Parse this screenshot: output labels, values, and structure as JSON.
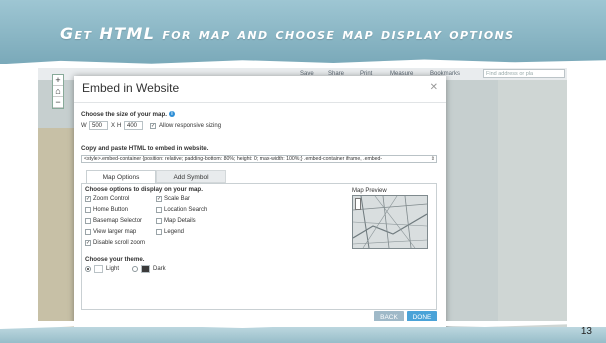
{
  "slide": {
    "title": "Get HTML for map and choose map display options",
    "page_number": "13"
  },
  "map_app": {
    "toolbar": {
      "save": "Save",
      "share": "Share",
      "print": "Print",
      "measure": "Measure",
      "bookmarks": "Bookmarks",
      "find_placeholder": "Find address or pla"
    }
  },
  "dialog": {
    "title": "Embed in Website",
    "size_label": "Choose the size of your map.",
    "width_prefix": "W",
    "width": "500",
    "x_sep": "X",
    "height_prefix": "H",
    "height": "400",
    "responsive_label": "Allow responsive sizing",
    "copy_label": "Copy and paste HTML to embed in website.",
    "html_code": "<style>.embed-container {position: relative; padding-bottom: 80%; height: 0; max-width: 100%;} .embed-container iframe, .embed-",
    "tabs": [
      "Map Options",
      "Add Symbol"
    ],
    "options_label": "Choose options to display on your map.",
    "options_left": [
      {
        "label": "Zoom Control",
        "checked": "yes"
      },
      {
        "label": "Home Button",
        "checked": "no"
      },
      {
        "label": "Basemap Selector",
        "checked": "no"
      },
      {
        "label": "View larger map",
        "checked": "no"
      },
      {
        "label": "Disable scroll zoom",
        "checked": "yes"
      }
    ],
    "options_right": [
      {
        "label": "Scale Bar",
        "checked": "yes"
      },
      {
        "label": "Location Search",
        "checked": "no"
      },
      {
        "label": "Map Details",
        "checked": "no"
      },
      {
        "label": "Legend",
        "checked": "no"
      }
    ],
    "preview_label": "Map Preview",
    "theme_label": "Choose your theme.",
    "theme_light": "Light",
    "theme_dark": "Dark",
    "selected_theme": "Light",
    "back_button": "BACK",
    "done_button": "DONE"
  },
  "colors": {
    "banner": "#8fbccb",
    "accent": "#2f8fd6",
    "back_button": "#9fb9c8",
    "done_button": "#4aa3d8"
  }
}
